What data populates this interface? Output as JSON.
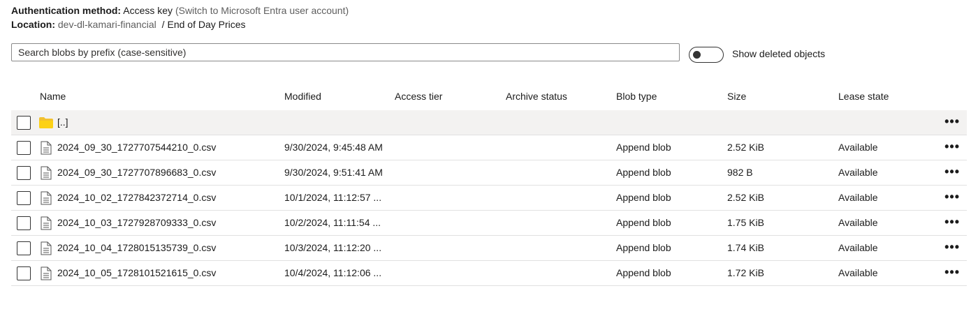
{
  "auth": {
    "label": "Authentication method:",
    "value": "Access key",
    "switch_link": "(Switch to Microsoft Entra user account)"
  },
  "location": {
    "label": "Location:",
    "container": "dev-dl-kamari-financial",
    "separator": "/",
    "folder": "End of Day Prices"
  },
  "search": {
    "placeholder": "Search blobs by prefix (case-sensitive)",
    "value": ""
  },
  "toggle": {
    "label": "Show deleted objects",
    "on": false
  },
  "columns": {
    "name": "Name",
    "modified": "Modified",
    "access_tier": "Access tier",
    "archive_status": "Archive status",
    "blob_type": "Blob type",
    "size": "Size",
    "lease_state": "Lease state"
  },
  "parent_row": {
    "name": "[..]",
    "more": "•••"
  },
  "rows": [
    {
      "name": "2024_09_30_1727707544210_0.csv",
      "modified": "9/30/2024, 9:45:48 AM",
      "access_tier": "",
      "archive_status": "",
      "blob_type": "Append blob",
      "size": "2.52 KiB",
      "lease_state": "Available",
      "more": "•••"
    },
    {
      "name": "2024_09_30_1727707896683_0.csv",
      "modified": "9/30/2024, 9:51:41 AM",
      "access_tier": "",
      "archive_status": "",
      "blob_type": "Append blob",
      "size": "982 B",
      "lease_state": "Available",
      "more": "•••"
    },
    {
      "name": "2024_10_02_1727842372714_0.csv",
      "modified": "10/1/2024, 11:12:57 ...",
      "access_tier": "",
      "archive_status": "",
      "blob_type": "Append blob",
      "size": "2.52 KiB",
      "lease_state": "Available",
      "more": "•••"
    },
    {
      "name": "2024_10_03_1727928709333_0.csv",
      "modified": "10/2/2024, 11:11:54 ...",
      "access_tier": "",
      "archive_status": "",
      "blob_type": "Append blob",
      "size": "1.75 KiB",
      "lease_state": "Available",
      "more": "•••"
    },
    {
      "name": "2024_10_04_1728015135739_0.csv",
      "modified": "10/3/2024, 11:12:20 ...",
      "access_tier": "",
      "archive_status": "",
      "blob_type": "Append blob",
      "size": "1.74 KiB",
      "lease_state": "Available",
      "more": "•••"
    },
    {
      "name": "2024_10_05_1728101521615_0.csv",
      "modified": "10/4/2024, 11:12:06 ...",
      "access_tier": "",
      "archive_status": "",
      "blob_type": "Append blob",
      "size": "1.72 KiB",
      "lease_state": "Available",
      "more": "•••"
    }
  ],
  "icons": {
    "folder": "folder-icon",
    "file": "file-icon",
    "more": "more-options-icon"
  },
  "colors": {
    "link": "#0f6cbd",
    "folder": "#f2c12e",
    "row_highlight": "#f3f2f1"
  }
}
